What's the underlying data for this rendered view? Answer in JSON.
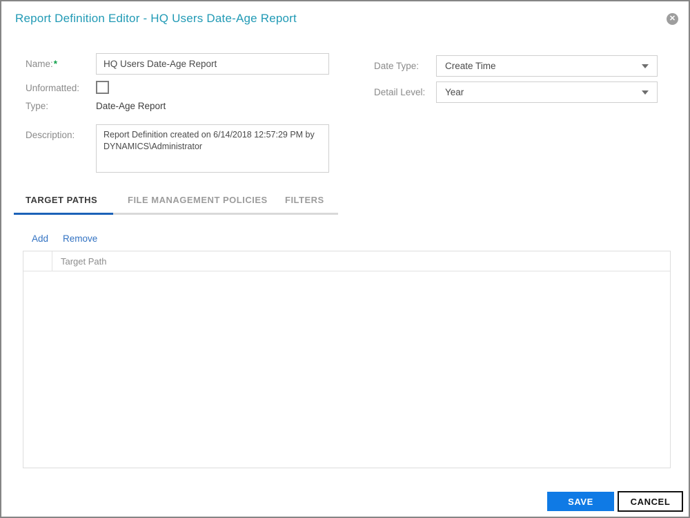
{
  "dialog": {
    "title": "Report Definition Editor - HQ Users Date-Age Report",
    "close_icon": "circle-x"
  },
  "form": {
    "name": {
      "label": "Name:",
      "required_mark": "*",
      "value": "HQ Users Date-Age Report"
    },
    "unformatted": {
      "label": "Unformatted:",
      "checked": false
    },
    "type": {
      "label": "Type:",
      "value": "Date-Age Report"
    },
    "description": {
      "label": "Description:",
      "value": "Report Definition created on 6/14/2018 12:57:29 PM by DYNAMICS\\Administrator"
    },
    "date_type": {
      "label": "Date Type:",
      "value": "Create Time"
    },
    "detail_level": {
      "label": "Detail Level:",
      "value": "Year"
    }
  },
  "tabs": [
    {
      "label": "TARGET PATHS",
      "active": true
    },
    {
      "label": "FILE MANAGEMENT POLICIES",
      "active": false
    },
    {
      "label": "FILTERS",
      "active": false
    }
  ],
  "toolbar": {
    "add_label": "Add",
    "remove_label": "Remove"
  },
  "table": {
    "columns": [
      "",
      "Target Path"
    ],
    "rows": []
  },
  "footer": {
    "save_label": "SAVE",
    "cancel_label": "CANCEL"
  },
  "colors": {
    "title_teal": "#219ab5",
    "save_blue": "#0f7ae5",
    "tab_underline_blue": "#1c62b8",
    "link_blue": "#3272c2",
    "required_green": "#11a14b",
    "label_gray": "#8a8a8a",
    "border_gray": "#858585"
  }
}
